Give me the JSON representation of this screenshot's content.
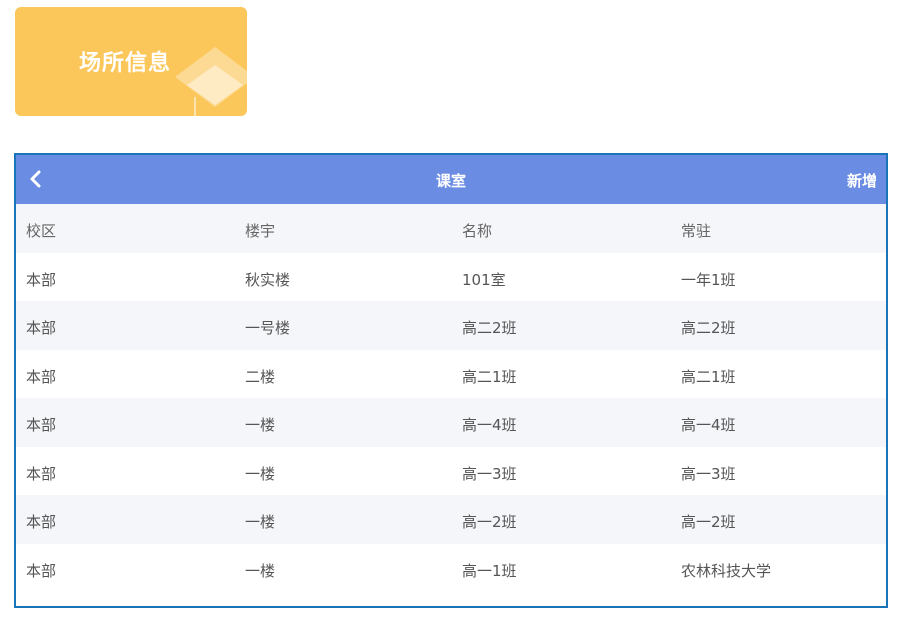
{
  "tile": {
    "label": "场所信息",
    "icon": "cube-icon",
    "color": "#fcc75a"
  },
  "panel": {
    "title": "课室",
    "back_icon": "chevron-left-icon",
    "add_label": "新增",
    "header_color": "#6b8ce3",
    "border_color": "#1a74b8"
  },
  "table": {
    "columns": [
      "校区",
      "楼宇",
      "名称",
      "常驻"
    ],
    "rows": [
      [
        "本部",
        "秋实楼",
        "101室",
        "一年1班"
      ],
      [
        "本部",
        "一号楼",
        "高二2班",
        "高二2班"
      ],
      [
        "本部",
        "二楼",
        "高二1班",
        "高二1班"
      ],
      [
        "本部",
        "一楼",
        "高一4班",
        "高一4班"
      ],
      [
        "本部",
        "一楼",
        "高一3班",
        "高一3班"
      ],
      [
        "本部",
        "一楼",
        "高一2班",
        "高一2班"
      ],
      [
        "本部",
        "一楼",
        "高一1班",
        "农林科技大学"
      ]
    ]
  }
}
